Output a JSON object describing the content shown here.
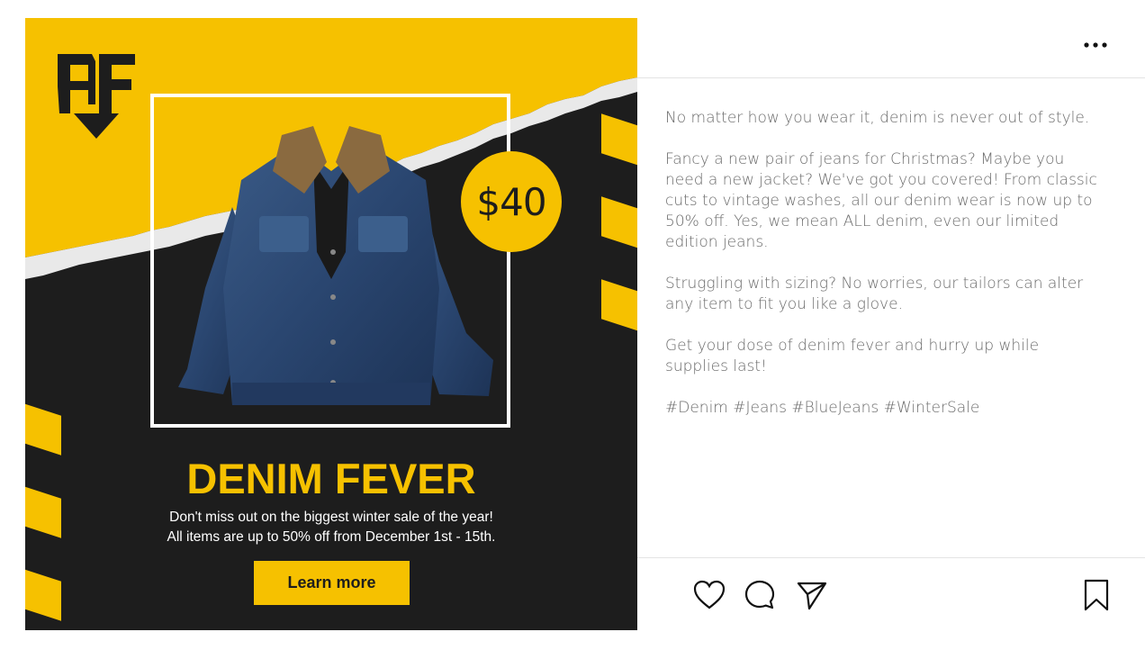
{
  "post": {
    "logo_text": "AF",
    "price": "$40",
    "headline": "DENIM FEVER",
    "subtext_line1": "Don't miss out on the biggest winter sale of the year!",
    "subtext_line2": "All items are up to 50% off from December 1st - 15th.",
    "cta_label": "Learn more",
    "product_image": "denim-jacket"
  },
  "caption": {
    "paragraphs": [
      "No matter how you wear it, denim is never out of style.",
      "Fancy a new pair of jeans for Christmas? Maybe you need a new jacket? We've got you covered! From classic cuts to vintage washes, all our denim wear is now up to 50% off. Yes, we mean ALL denim, even our limited edition jeans.",
      "Struggling with sizing? No worries, our tailors can alter any item to fit you like a glove.",
      "Get your dose of denim fever and hurry up while supplies last!",
      "#Denim #Jeans #BlueJeans #WinterSale"
    ]
  },
  "icons": {
    "more": "more-horizontal-icon",
    "like": "heart-icon",
    "comment": "comment-bubble-icon",
    "share": "send-plane-icon",
    "save": "bookmark-icon"
  },
  "colors": {
    "brand_yellow": "#f6c100",
    "background_dark": "#1d1d1d",
    "caption_text": "#6b6b6b"
  }
}
